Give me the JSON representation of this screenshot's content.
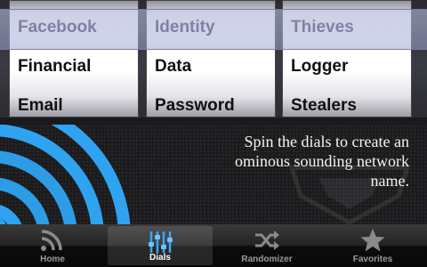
{
  "picker": {
    "wheels": [
      {
        "above": "",
        "selected": "Facebook",
        "next": "Financial",
        "last": "Email"
      },
      {
        "above": "",
        "selected": "Identity",
        "next": "Data",
        "last": "Password"
      },
      {
        "above": "",
        "selected": "Thieves",
        "next": "Logger",
        "last": "Stealers"
      }
    ]
  },
  "content": {
    "tagline": "Spin the dials to create an ominous sounding network name."
  },
  "tabs": [
    {
      "label": "Home",
      "icon": "wifi-icon"
    },
    {
      "label": "Dials",
      "icon": "sliders-icon",
      "active": true
    },
    {
      "label": "Randomizer",
      "icon": "shuffle-icon"
    },
    {
      "label": "Favorites",
      "icon": "star-icon"
    }
  ],
  "colors": {
    "accent": "#2a9df4",
    "tab_active_label": "#ffffff",
    "tab_label": "#9a9a9a"
  }
}
